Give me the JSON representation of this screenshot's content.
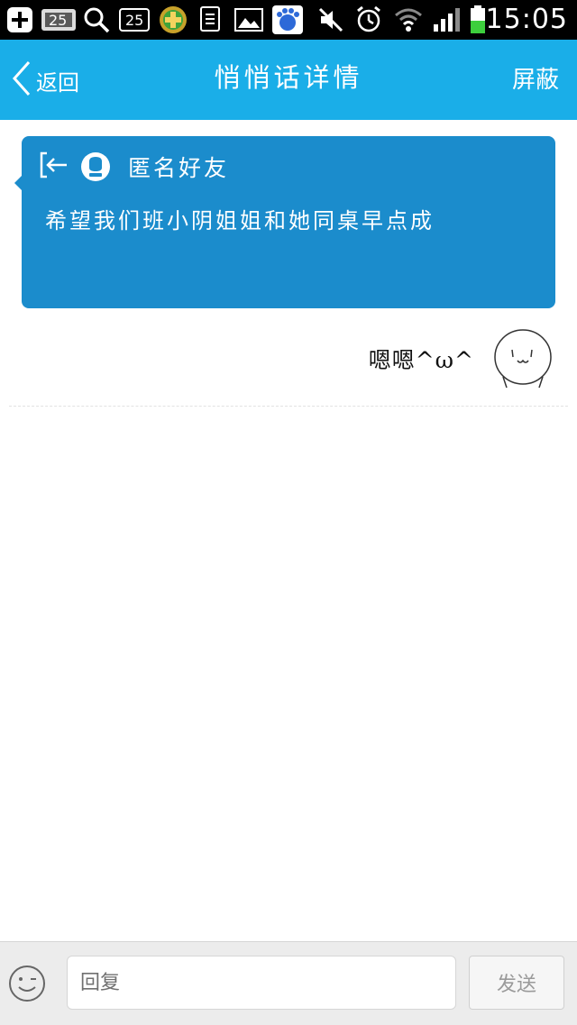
{
  "status_bar": {
    "time": "15:05",
    "notification_badge_1": "25",
    "notification_badge_2": "25",
    "icons": [
      "add-icon",
      "sms-badge-icon",
      "search-icon",
      "calendar-icon",
      "plus-app-icon",
      "document-icon",
      "image-icon",
      "baidu-icon",
      "mute-icon",
      "alarm-icon",
      "wifi-icon",
      "signal-icon",
      "battery-icon"
    ]
  },
  "header": {
    "back_label": "返回",
    "title": "悄悄话详情",
    "block_label": "屏蔽",
    "background_color": "#1aaee8"
  },
  "message": {
    "sender": "匿名好友",
    "body": "希望我们班小阴姐姐和她同桌早点成",
    "card_color": "#1b8ccc"
  },
  "reply": {
    "text": "嗯嗯^ω^"
  },
  "composer": {
    "placeholder": "回复",
    "send_label": "发送"
  }
}
